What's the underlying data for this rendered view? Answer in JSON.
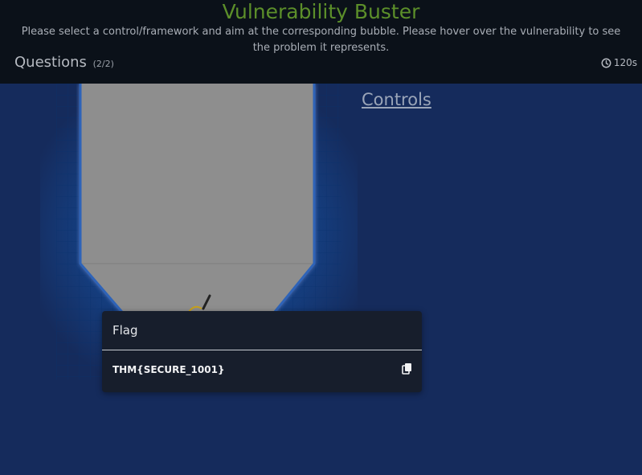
{
  "header": {
    "title": "Vulnerability Buster",
    "subtitle": "Please select a control/framework and aim at the corresponding bubble. Please hover over the vulnerability to see the problem it represents.",
    "questions_label": "Questions",
    "questions_count": "(2/2)",
    "timer": "120s",
    "timer_icon": "clock-icon"
  },
  "game": {
    "controls_label": "Controls"
  },
  "flag_modal": {
    "title": "Flag",
    "value": "THM{SECURE_1001}",
    "copy_icon": "copy-icon"
  },
  "colors": {
    "title": "#5c8f2a",
    "background": "#152b5c",
    "header_bg": "#0b1119",
    "card_bg": "#171e2c"
  }
}
